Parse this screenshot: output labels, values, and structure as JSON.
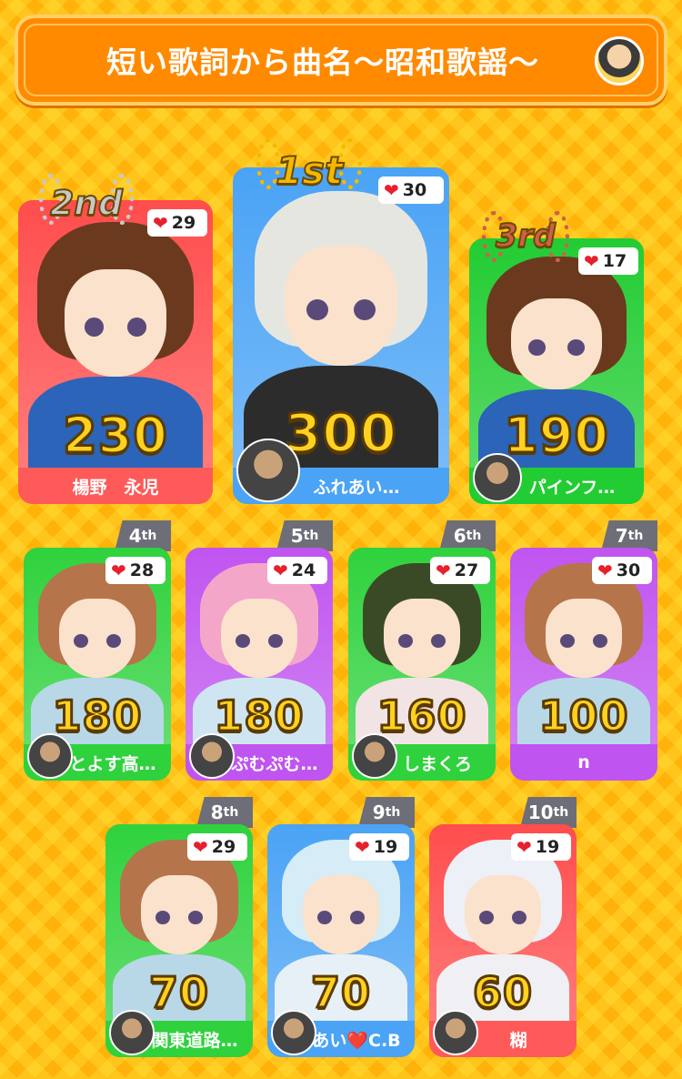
{
  "header": {
    "title": "短い歌詞から曲名〜昭和歌謡〜"
  },
  "podium": [
    {
      "rank": "1st",
      "likes": "30",
      "score": "300",
      "name": "ふれあい…",
      "bg": "#4aa3f5",
      "bar": "#4aa3f5",
      "hair": "#e6e6e0",
      "body": "#2c2c2c",
      "laurel": "#f5b800"
    },
    {
      "rank": "2nd",
      "likes": "29",
      "score": "230",
      "name": "楊野　永児",
      "bg": "#ff4d4d",
      "bar": "#ff5a5a",
      "hair": "#6b3a1e",
      "body": "#2b64b8",
      "laurel": "#c8c8cc"
    },
    {
      "rank": "3rd",
      "likes": "17",
      "score": "190",
      "name": "パインフ…",
      "bg": "#22cc33",
      "bar": "#22cc33",
      "hair": "#6b3a1e",
      "body": "#2b64b8",
      "laurel": "#d0604a"
    }
  ],
  "row2": [
    {
      "rank": "4",
      "suffix": "th",
      "likes": "28",
      "score": "180",
      "name": "とよす高…",
      "bg": "#2fd23d",
      "bar": "#2fd23d",
      "hair": "#b6744a",
      "body": "#b8d8e8"
    },
    {
      "rank": "5",
      "suffix": "th",
      "likes": "24",
      "score": "180",
      "name": "ぷむぷむ…",
      "bg": "#c054f0",
      "bar": "#c054f0",
      "hair": "#f4a6c8",
      "body": "#cfe6f2"
    },
    {
      "rank": "6",
      "suffix": "th",
      "likes": "27",
      "score": "160",
      "name": "しまくろ",
      "bg": "#2fd23d",
      "bar": "#2fd23d",
      "hair": "#3b4a26",
      "body": "#f2e4e4"
    },
    {
      "rank": "7",
      "suffix": "th",
      "likes": "30",
      "score": "100",
      "name": "n",
      "bg": "#c054f0",
      "bar": "#c054f0",
      "hair": "#b6744a",
      "body": "#b8d8e8"
    }
  ],
  "row3": [
    {
      "rank": "8",
      "suffix": "th",
      "likes": "29",
      "score": "70",
      "name": "関東道路…",
      "bg": "#2fd23d",
      "bar": "#2fd23d",
      "hair": "#b6744a",
      "body": "#b8d8e8"
    },
    {
      "rank": "9",
      "suffix": "th",
      "likes": "19",
      "score": "70",
      "name": "あい❤️C.B",
      "bg": "#4aa3f5",
      "bar": "#4aa3f5",
      "hair": "#d6ecf6",
      "body": "#e6f0f6"
    },
    {
      "rank": "10",
      "suffix": "th",
      "likes": "19",
      "score": "60",
      "name": "糊",
      "bg": "#ff4d4d",
      "bar": "#ff5a5a",
      "hair": "#eef0f8",
      "body": "#f0f0f4"
    }
  ]
}
